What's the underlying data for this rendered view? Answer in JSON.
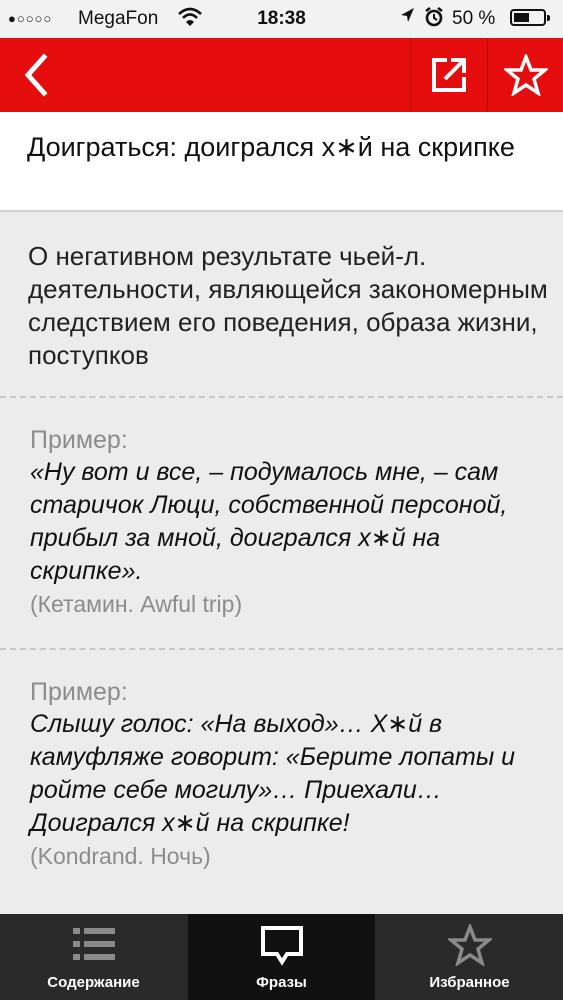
{
  "status_bar": {
    "signal_dots": "●○○○○",
    "carrier": "MegaFon",
    "time": "18:38",
    "battery": "50 %"
  },
  "nav": {
    "back_icon": "chevron-left-icon",
    "share_icon": "share-icon",
    "favorite_icon": "star-icon"
  },
  "entry": {
    "title": "Доиграться: доигрался х∗й на скрипке",
    "definition": "О негативном результате чьей-л. деятельности, являющейся закономерным следствием его поведения, образа жизни, поступков",
    "examples": [
      {
        "label": "Пример:",
        "quote": "«Ну вот и все, – подумалось мне, – сам старичок Люци, собственной персоной, прибыл за мной, доигрался х∗й на скрипке».",
        "source": "(Кетамин. Awful trip)"
      },
      {
        "label": "Пример:",
        "quote": "Слышу голос: «На выход»… Х∗й в камуфляже говорит: «Берите лопаты и ройте себе могилу»… Приехали… Доигрался х∗й на скрипке!",
        "source": "(Kondrand. Ночь)"
      }
    ]
  },
  "tabs": [
    {
      "label": "Содержание",
      "icon": "list-icon",
      "active": false
    },
    {
      "label": "Фразы",
      "icon": "speech-bubble-icon",
      "active": true
    },
    {
      "label": "Избранное",
      "icon": "star-icon",
      "active": false
    }
  ],
  "colors": {
    "accent": "#e50d0d",
    "tab_bar": "#2a2a2a",
    "tab_active": "#111111"
  }
}
